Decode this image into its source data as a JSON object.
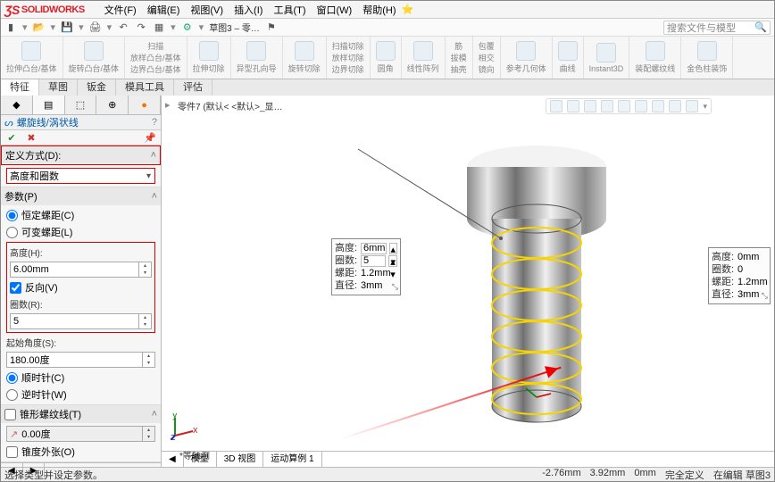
{
  "app": {
    "brand": "SOLIDWORKS"
  },
  "menu": [
    "文件(F)",
    "编辑(E)",
    "视图(V)",
    "插入(I)",
    "工具(T)",
    "窗口(W)",
    "帮助(H)"
  ],
  "toolbar": {
    "doc_label": "草图3 – 零…",
    "search_ph": "搜索文件与模型"
  },
  "ribbon": {
    "g1": {
      "label": "拉伸凸台/基体"
    },
    "g2": {
      "label": "旋转凸台/基体"
    },
    "g3": {
      "a": "扫描",
      "b": "放样凸台/基体",
      "c": "边界凸台/基体"
    },
    "g4": {
      "label": "拉伸切除"
    },
    "g5": {
      "label": "异型孔向导"
    },
    "g6": {
      "label": "旋转切除"
    },
    "g7": {
      "a": "扫描切除",
      "b": "放样切除",
      "c": "边界切除"
    },
    "g8": {
      "label": "圆角"
    },
    "g9": {
      "label": "线性阵列"
    },
    "g10": {
      "a": "筋",
      "b": "拔模",
      "c": "抽壳"
    },
    "g11": {
      "a": "包覆",
      "b": "相交",
      "c": "镜向"
    },
    "g12": {
      "label": "参考几何体"
    },
    "g13": {
      "label": "曲线"
    },
    "g14": {
      "label": "Instant3D"
    },
    "g15": {
      "label": "装配螺纹线"
    },
    "g16": {
      "label": "金色柱装饰"
    }
  },
  "tabs": [
    "特征",
    "草图",
    "钣金",
    "模具工具",
    "评估"
  ],
  "pm": {
    "title": "螺旋线/涡状线",
    "sec_def": "定义方式(D):",
    "def_value": "高度和圈数",
    "sec_param": "参数(P)",
    "r1": "恒定螺距(C)",
    "r2": "可变螺距(L)",
    "height_label": "高度(H):",
    "height_val": "6.00mm",
    "reverse": "反向(V)",
    "turns_label": "圈数(R):",
    "turns_val": "5",
    "start_label": "起始角度(S):",
    "start_val": "180.00度",
    "r3": "顺时针(C)",
    "r4": "逆时针(W)",
    "taper": "锥形螺纹线(T)",
    "taper_val": "0.00度",
    "taper_out": "锥度外张(O)"
  },
  "canvas": {
    "part": "零件7  (默认< <默认>_显…",
    "view": "*等轴测",
    "fp1": {
      "h": "6mm",
      "n": "5",
      "p": "1.2mm",
      "d": "3mm"
    },
    "fp2": {
      "h": "0mm",
      "n": "0",
      "p": "1.2mm",
      "d": "3mm"
    },
    "fp_labels": {
      "height": "高度:",
      "turns": "圈数:",
      "pitch": "螺距:",
      "dia": "直径:"
    }
  },
  "bottomtabs": {
    "a": "模型",
    "b": "3D 视图",
    "c": "运动算例 1"
  },
  "status": {
    "hint": "选择类型并设定参数。",
    "x": "-2.76mm",
    "y": "3.92mm",
    "z": "0mm",
    "def": "完全定义",
    "edit": "在编辑 草图3"
  }
}
